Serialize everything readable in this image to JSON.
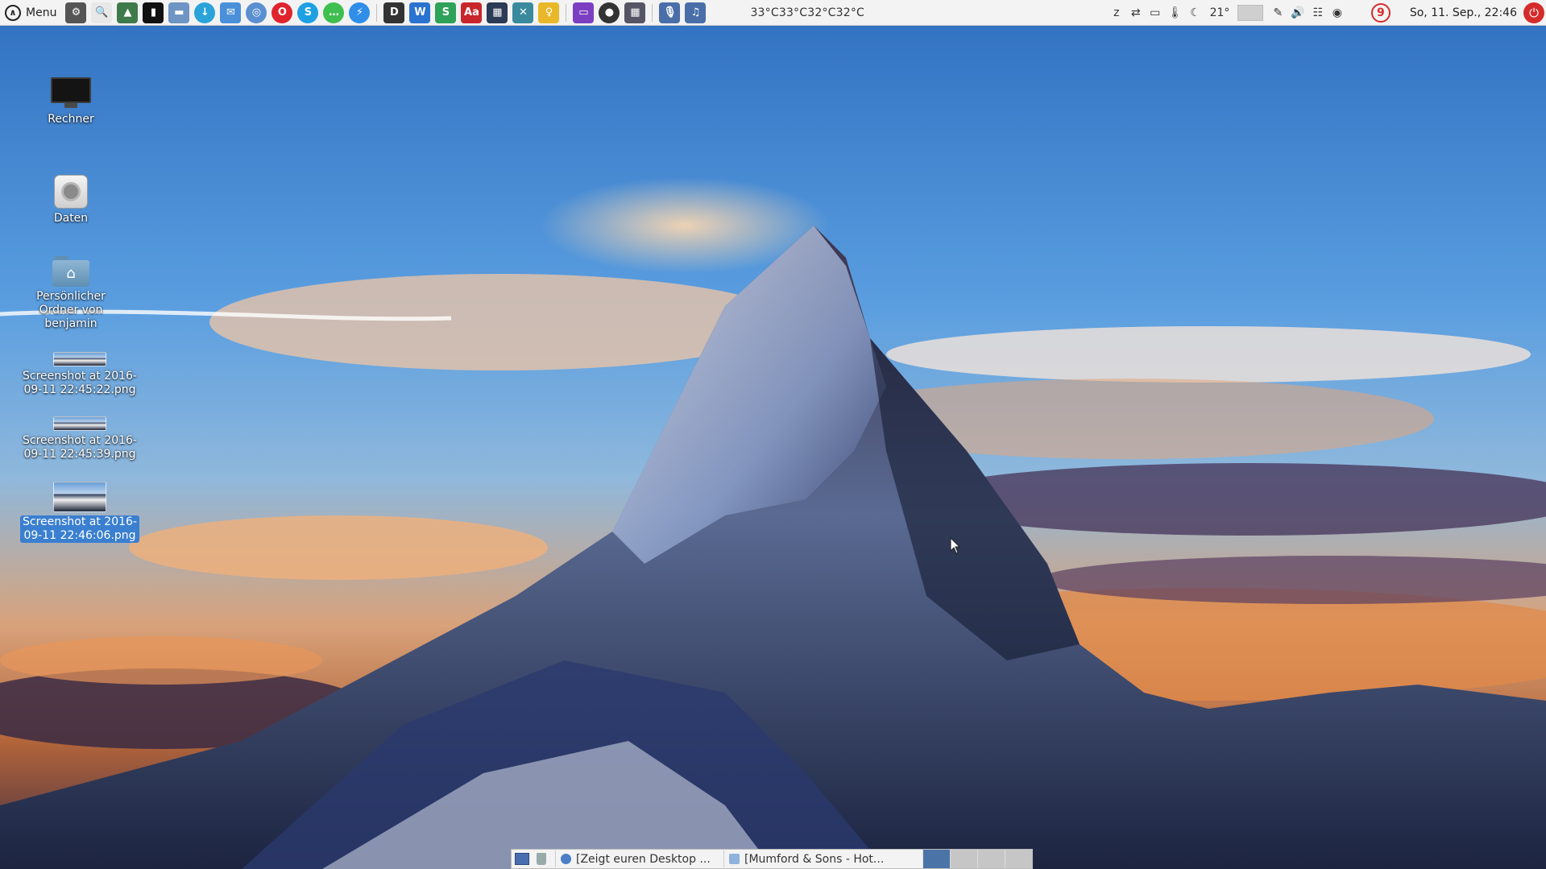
{
  "panel": {
    "menu_label": "Menu",
    "launchers": [
      {
        "name": "system-settings-icon",
        "glyph": "⚙",
        "bg": "#555555"
      },
      {
        "name": "search-icon",
        "glyph": "🔍",
        "bg": "#e8e8e8"
      },
      {
        "name": "image-viewer-icon",
        "glyph": "▲",
        "bg": "#3f7a4a"
      },
      {
        "name": "terminal-icon",
        "glyph": "▮",
        "bg": "#111111"
      },
      {
        "name": "file-manager-icon",
        "glyph": "▬",
        "bg": "#6e95c4"
      },
      {
        "name": "download-icon",
        "glyph": "↓",
        "bg": "#2aa3d8",
        "round": true
      },
      {
        "name": "mail-icon",
        "glyph": "✉",
        "bg": "#4a90d9"
      },
      {
        "name": "browser-icon",
        "glyph": "◎",
        "bg": "#5a8fd0",
        "round": true
      },
      {
        "name": "opera-icon",
        "glyph": "O",
        "bg": "#e0242e",
        "round": true
      },
      {
        "name": "skype-icon",
        "glyph": "S",
        "bg": "#1da1e2",
        "round": true
      },
      {
        "name": "chat-icon",
        "glyph": "…",
        "bg": "#3fbf4f",
        "round": true
      },
      {
        "name": "messenger-icon",
        "glyph": "⚡",
        "bg": "#2f8ee8",
        "round": true
      }
    ],
    "launchers2": [
      {
        "name": "document-icon",
        "glyph": "D",
        "bg": "#333333"
      },
      {
        "name": "writer-icon",
        "glyph": "W",
        "bg": "#2b73d0"
      },
      {
        "name": "spreadsheet-icon",
        "glyph": "S",
        "bg": "#2fa25a"
      },
      {
        "name": "pdf-reader-icon",
        "glyph": "Aa",
        "bg": "#c8262a"
      },
      {
        "name": "calculator-icon",
        "glyph": "▦",
        "bg": "#2b3a55"
      },
      {
        "name": "tools-icon",
        "glyph": "✕",
        "bg": "#3a8a9e"
      },
      {
        "name": "keyring-icon",
        "glyph": "♀",
        "bg": "#e8b82a"
      }
    ],
    "launchers3": [
      {
        "name": "display-icon",
        "glyph": "▭",
        "bg": "#7d3fc2"
      },
      {
        "name": "media-player-icon",
        "glyph": "●",
        "bg": "#333333",
        "round": true
      },
      {
        "name": "workspace-grid-icon",
        "glyph": "▦",
        "bg": "#555566"
      }
    ],
    "launchers4": [
      {
        "name": "microphone-icon",
        "glyph": "🎙",
        "bg": "#4a6fa8"
      },
      {
        "name": "music-icon",
        "glyph": "♫",
        "bg": "#4a6fa8"
      }
    ],
    "temperatures": "33°C33°C32°C32°C",
    "tray": [
      {
        "name": "sleep-icon",
        "glyph": "z"
      },
      {
        "name": "network-manager-icon",
        "glyph": "⇄"
      },
      {
        "name": "monitor-icon",
        "glyph": "▭"
      },
      {
        "name": "thermometer-icon",
        "glyph": "🌡"
      },
      {
        "name": "weather-moon-icon",
        "glyph": "☾"
      }
    ],
    "weather_temp": "21°",
    "tray2": [
      {
        "name": "pen-icon",
        "glyph": "✎"
      },
      {
        "name": "volume-icon",
        "glyph": "🔊"
      },
      {
        "name": "mixer-icon",
        "glyph": "☷"
      },
      {
        "name": "sync-icon",
        "glyph": "◉"
      }
    ],
    "notification_count": "9",
    "clock": "So, 11. Sep., 22:46"
  },
  "desktop": {
    "icons": [
      {
        "id": "rechner",
        "lines": [
          "Rechner"
        ]
      },
      {
        "id": "daten",
        "lines": [
          "Daten"
        ]
      },
      {
        "id": "home",
        "lines": [
          "Persönlicher",
          "Ordner von",
          "benjamin"
        ]
      },
      {
        "id": "shot1",
        "lines": [
          "Screenshot at 2016-",
          "09-11 22:45:22.png"
        ]
      },
      {
        "id": "shot2",
        "lines": [
          "Screenshot at 2016-",
          "09-11 22:45:39.png"
        ]
      },
      {
        "id": "shot3",
        "lines": [
          "Screenshot at 2016-",
          "09-11 22:46:06.png"
        ]
      }
    ]
  },
  "taskbar": {
    "tasks": [
      {
        "label": "[Zeigt euren Desktop ..."
      },
      {
        "label": "[Mumford & Sons - Hot..."
      }
    ],
    "workspace_count": 4,
    "active_workspace": 1
  },
  "colors": {
    "panel_bg": "#f3f3f3",
    "selection": "#3a7fd0",
    "notification_red": "#d62b2b"
  }
}
